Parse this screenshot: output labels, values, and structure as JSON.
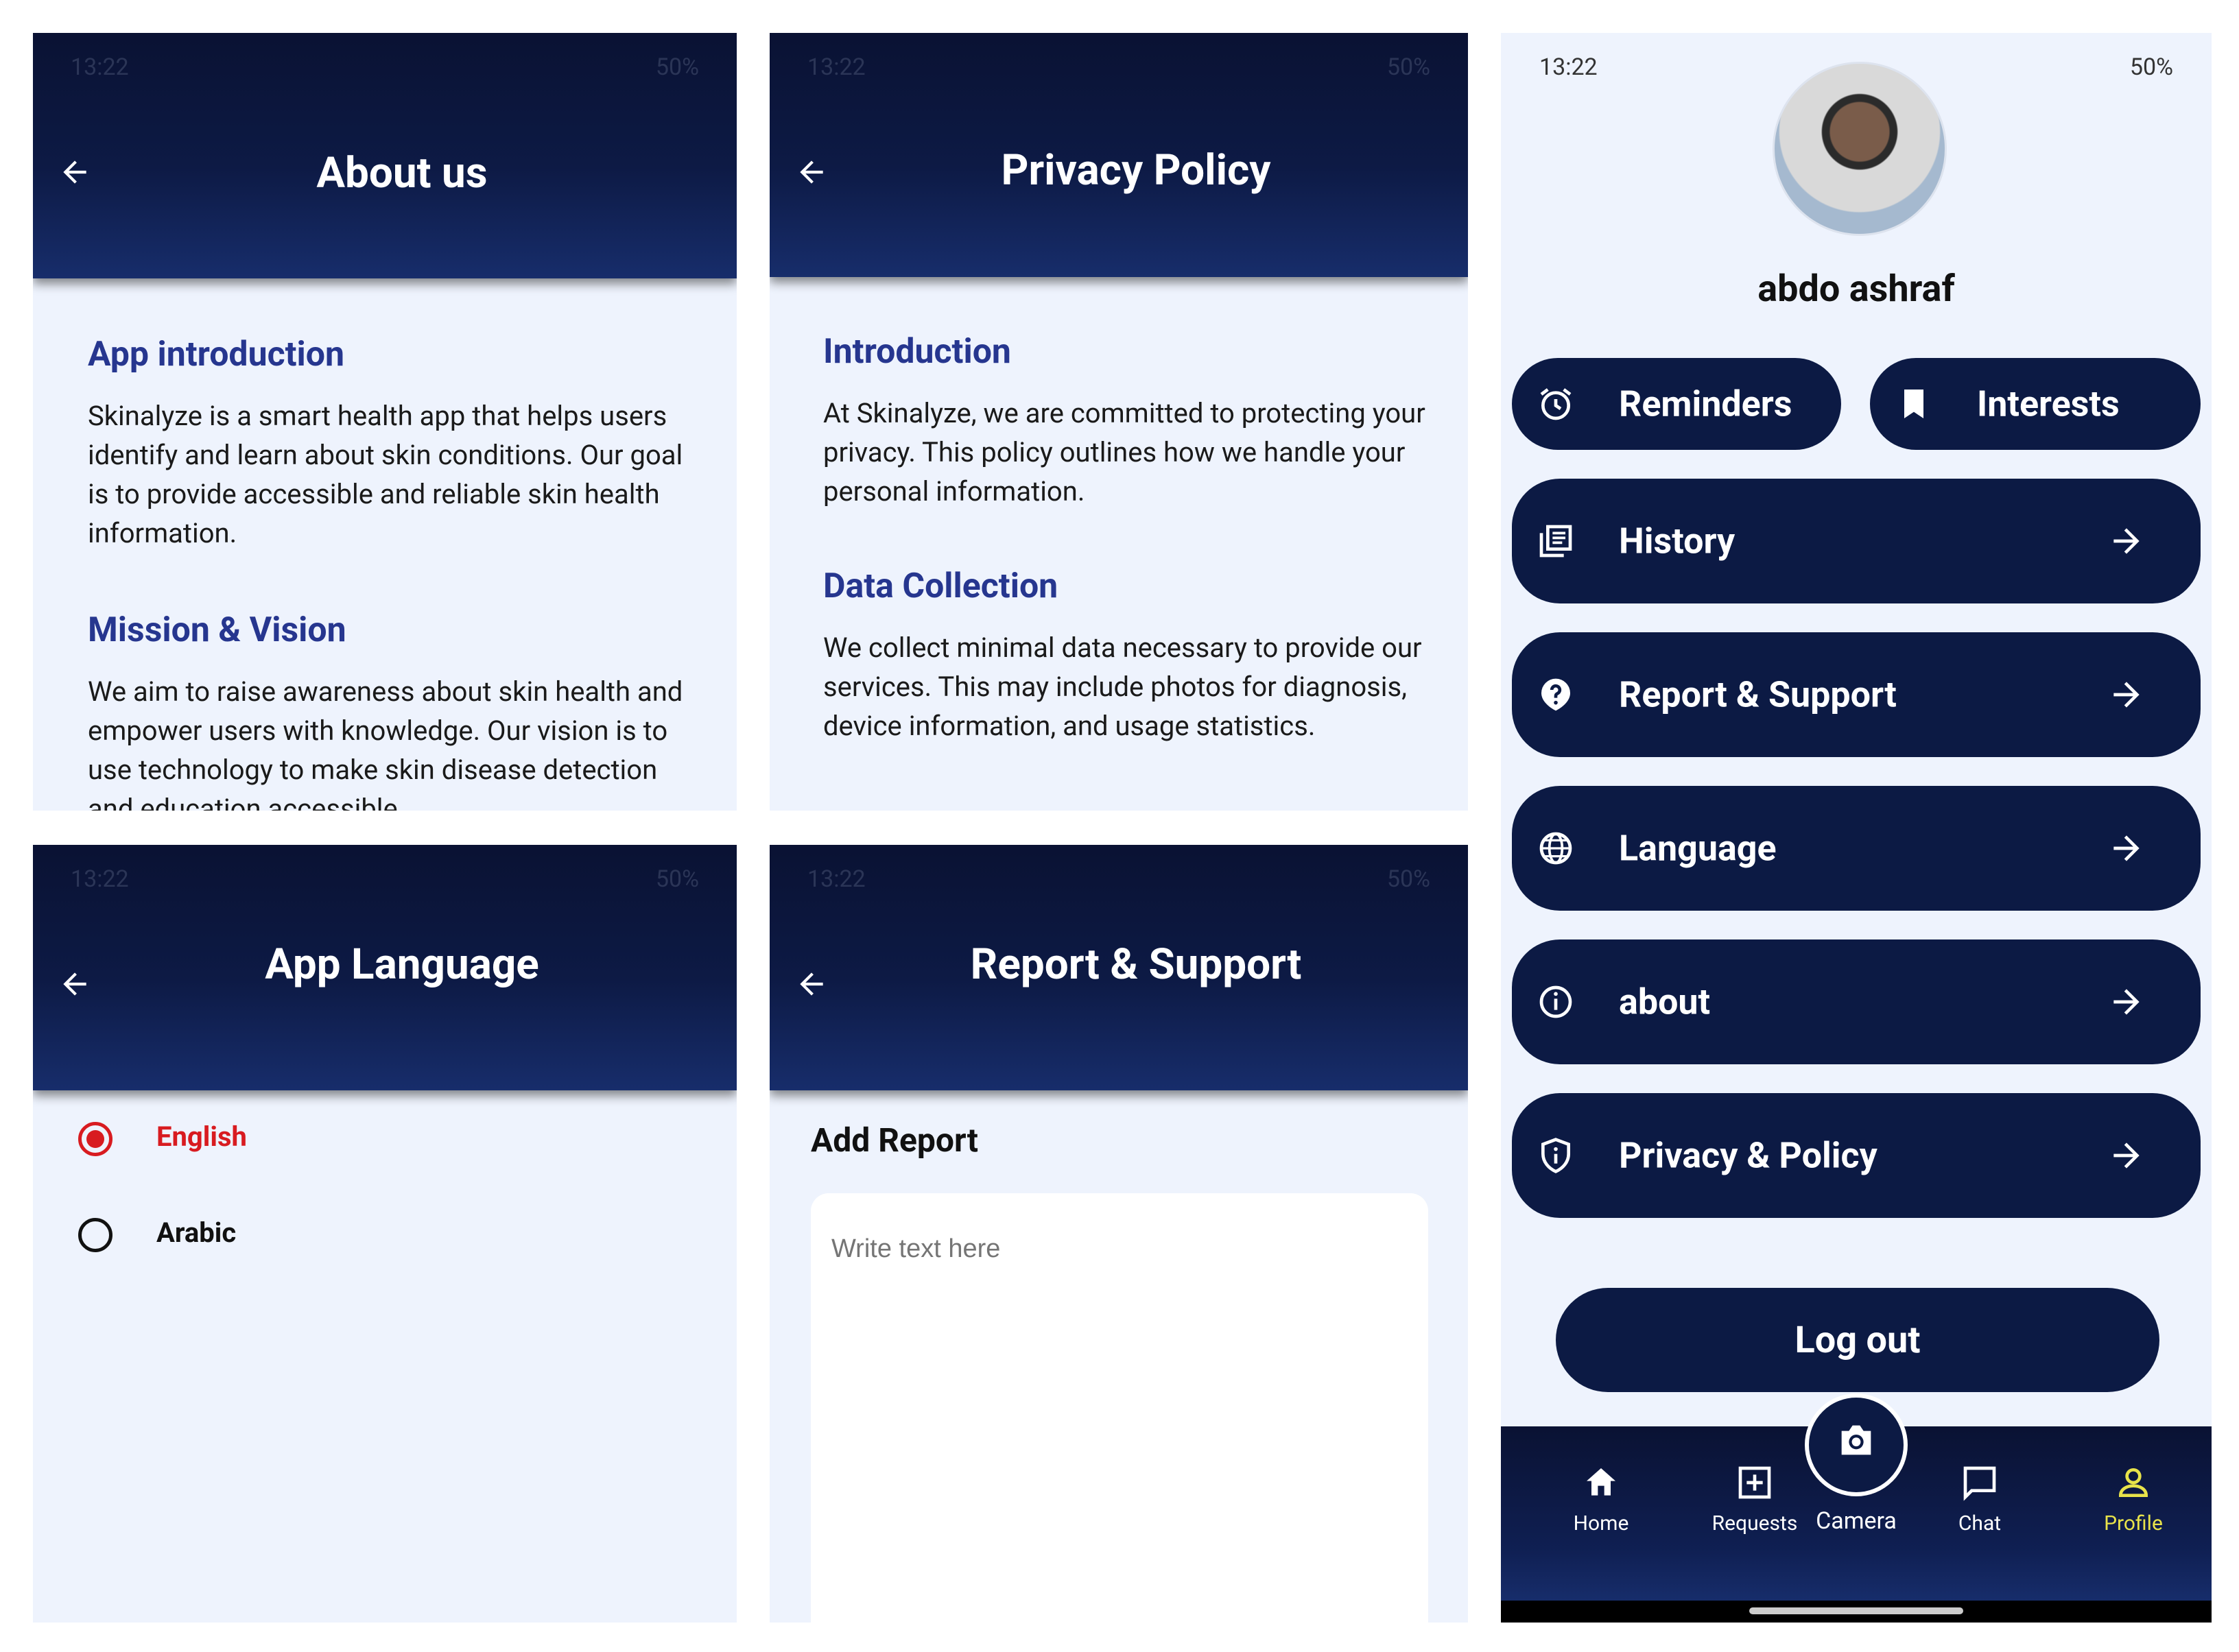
{
  "status_bar": {
    "time": "13:22",
    "battery": "50%"
  },
  "about": {
    "title": "About us",
    "sec1_heading": "App introduction",
    "sec1_body": "Skinalyze is a smart health app that helps users identify and learn about skin conditions. Our goal is to provide accessible and reliable skin health information.",
    "sec2_heading": "Mission & Vision",
    "sec2_body": "We aim to raise awareness about skin health and empower users with knowledge. Our vision is to use technology to make skin disease detection and education accessible"
  },
  "privacy": {
    "title": "Privacy Policy",
    "sec1_heading": "Introduction",
    "sec1_body": "At Skinalyze, we are committed to protecting your privacy. This policy outlines how we handle your personal information.",
    "sec2_heading": "Data Collection",
    "sec2_body": "We collect minimal data necessary to provide our services. This may include photos for diagnosis, device information, and usage statistics."
  },
  "language": {
    "title": "App Language",
    "options": [
      {
        "label": "English",
        "selected": true
      },
      {
        "label": "Arabic",
        "selected": false
      }
    ]
  },
  "report": {
    "title": "Report & Support",
    "heading": "Add Report",
    "placeholder": "Write text here"
  },
  "profile": {
    "name": "abdo ashraf",
    "reminders": "Reminders",
    "interests": "Interests",
    "menu": [
      "History",
      "Report & Support",
      "Language",
      "about",
      "Privacy & Policy"
    ],
    "logout": "Log out"
  },
  "nav": {
    "items": [
      "Home",
      "Requests",
      "Camera",
      "Chat",
      "Profile"
    ],
    "active": "Profile",
    "active_color": "#e8e34a"
  },
  "colors": {
    "navy": "#0c1a44",
    "heading_blue": "#26368f",
    "accent_red": "#d81b20",
    "panel_bg": "#eef3fd"
  }
}
